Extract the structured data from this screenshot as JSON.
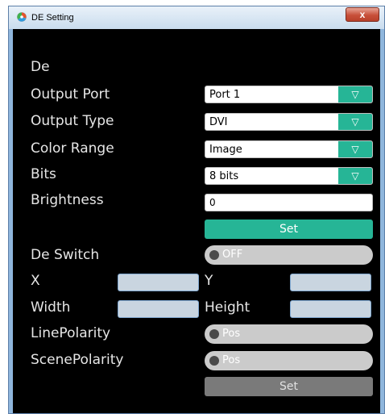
{
  "window": {
    "title": "DE Setting",
    "close_label": "x"
  },
  "form": {
    "section_label": "De",
    "output_port": {
      "label": "Output Port",
      "value": "Port 1"
    },
    "output_type": {
      "label": "Output Type",
      "value": "DVI"
    },
    "color_range": {
      "label": "Color Range",
      "value": "Image"
    },
    "bits": {
      "label": "Bits",
      "value": "8 bits"
    },
    "brightness": {
      "label": "Brightness",
      "value": "0"
    },
    "set_label": "Set",
    "de_switch": {
      "label": "De Switch",
      "state": "OFF"
    },
    "x": {
      "label": "X",
      "value": ""
    },
    "y": {
      "label": "Y",
      "value": ""
    },
    "width": {
      "label": "Width",
      "value": ""
    },
    "height": {
      "label": "Height",
      "value": ""
    },
    "line_polarity": {
      "label": "LinePolarity",
      "state": "Pos"
    },
    "scene_polarity": {
      "label": "ScenePolarity",
      "state": "Pos"
    },
    "set2_label": "Set",
    "dropdown_arrow": "▽"
  },
  "colors": {
    "accent": "#26b596",
    "background": "#000000",
    "disabled_button": "#7a7a7a",
    "toggle_track": "#cbcbcb"
  }
}
